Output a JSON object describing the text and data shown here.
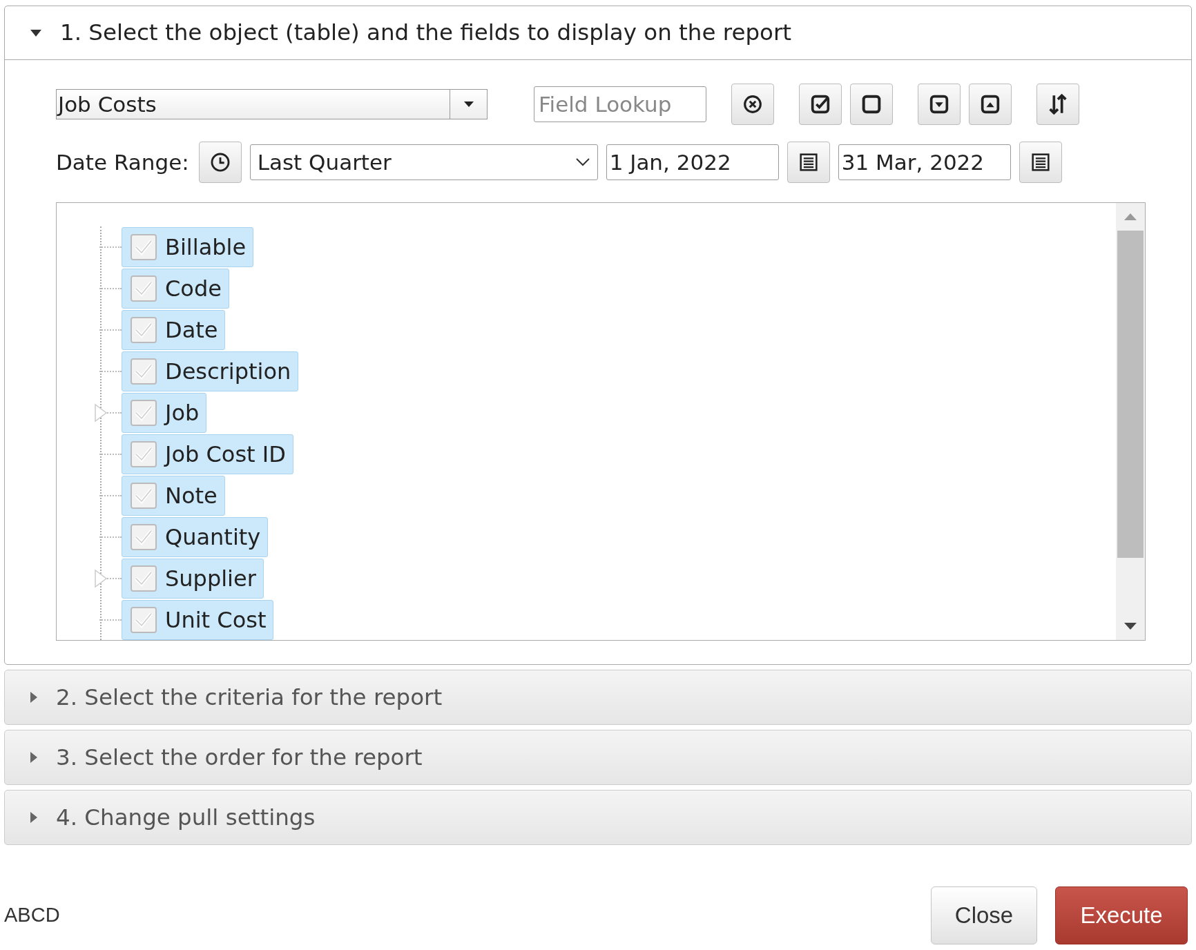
{
  "sections": [
    {
      "title": "1. Select the object (table) and the fields to display on the report",
      "expanded": true
    },
    {
      "title": "2. Select the criteria for the report",
      "expanded": false
    },
    {
      "title": "3. Select the order for the report",
      "expanded": false
    },
    {
      "title": "4. Change pull settings",
      "expanded": false
    }
  ],
  "object_select": {
    "value": "Job Costs"
  },
  "field_lookup": {
    "placeholder": "Field Lookup"
  },
  "date_range": {
    "label": "Date Range:",
    "period": "Last Quarter",
    "from": "1 Jan, 2022",
    "to": "31 Mar, 2022"
  },
  "fields": [
    {
      "label": "Billable",
      "checked": true,
      "has_children": false
    },
    {
      "label": "Code",
      "checked": true,
      "has_children": false
    },
    {
      "label": "Date",
      "checked": true,
      "has_children": false
    },
    {
      "label": "Description",
      "checked": true,
      "has_children": false
    },
    {
      "label": "Job",
      "checked": true,
      "has_children": true
    },
    {
      "label": "Job Cost ID",
      "checked": true,
      "has_children": false
    },
    {
      "label": "Note",
      "checked": true,
      "has_children": false
    },
    {
      "label": "Quantity",
      "checked": true,
      "has_children": false
    },
    {
      "label": "Supplier",
      "checked": true,
      "has_children": true
    },
    {
      "label": "Unit Cost",
      "checked": true,
      "has_children": false
    }
  ],
  "footer": {
    "text": "ABCD",
    "buttons": [
      {
        "label": "Close",
        "kind": "secondary"
      },
      {
        "label": "Execute",
        "kind": "primary"
      }
    ]
  }
}
